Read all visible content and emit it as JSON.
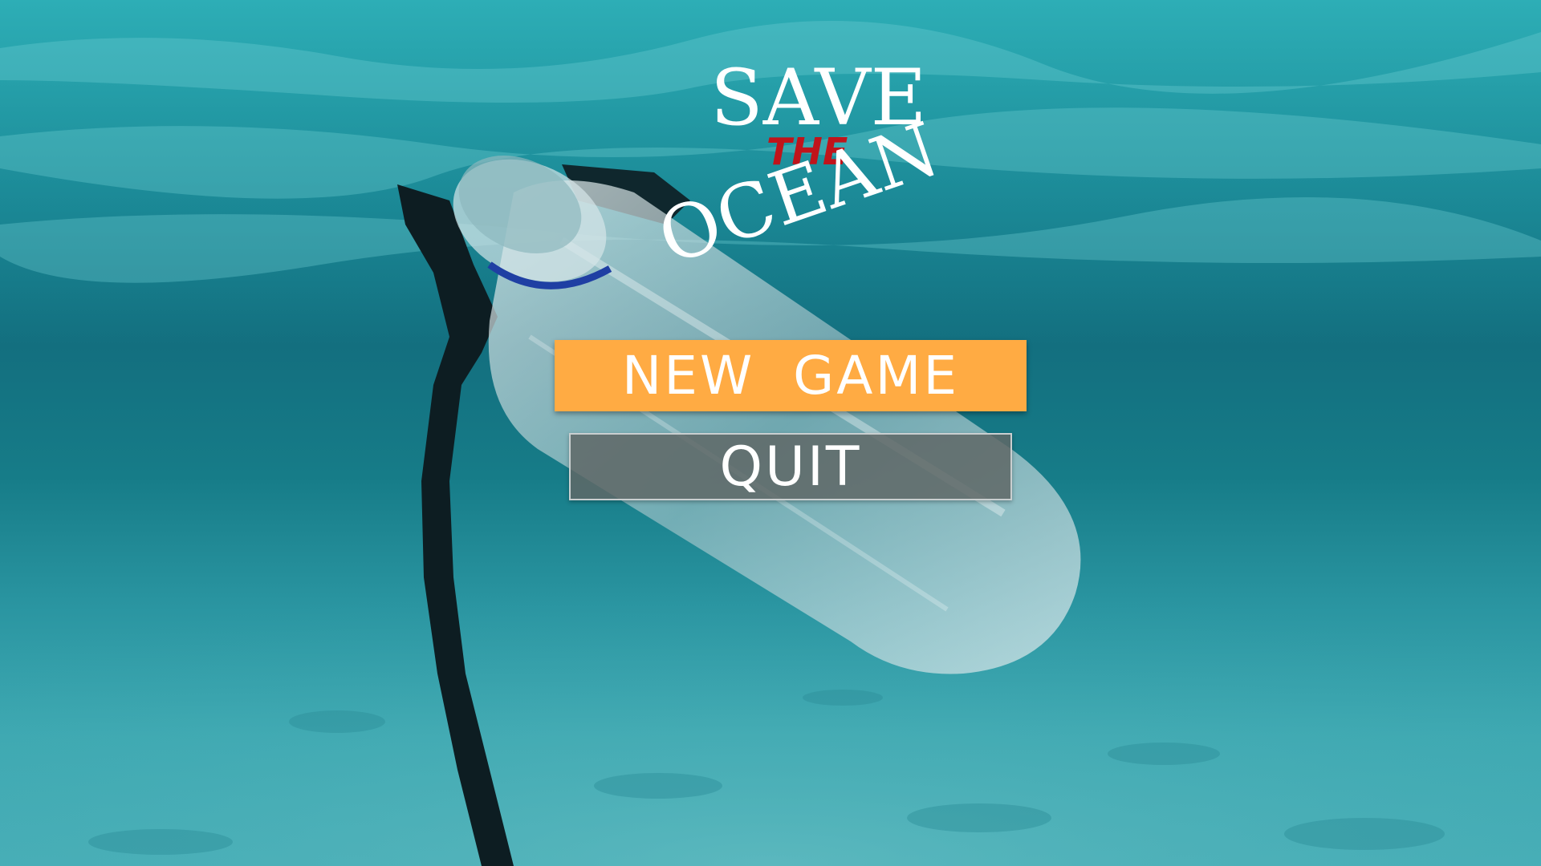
{
  "game": {
    "title_line1": "SAVE",
    "title_line2": "THE",
    "title_line3": "OCEAN",
    "background_scene": "underwater plastic bottle"
  },
  "menu": {
    "new_game_label": "NEW  GAME",
    "quit_label": "QUIT"
  },
  "colors": {
    "title_white": "#ffffff",
    "title_red": "#c0141b",
    "new_game_bg": "#ffab43",
    "quit_bg": "#5f6766",
    "water_top": "#1f9aa4",
    "water_bottom": "#46aeb7"
  }
}
